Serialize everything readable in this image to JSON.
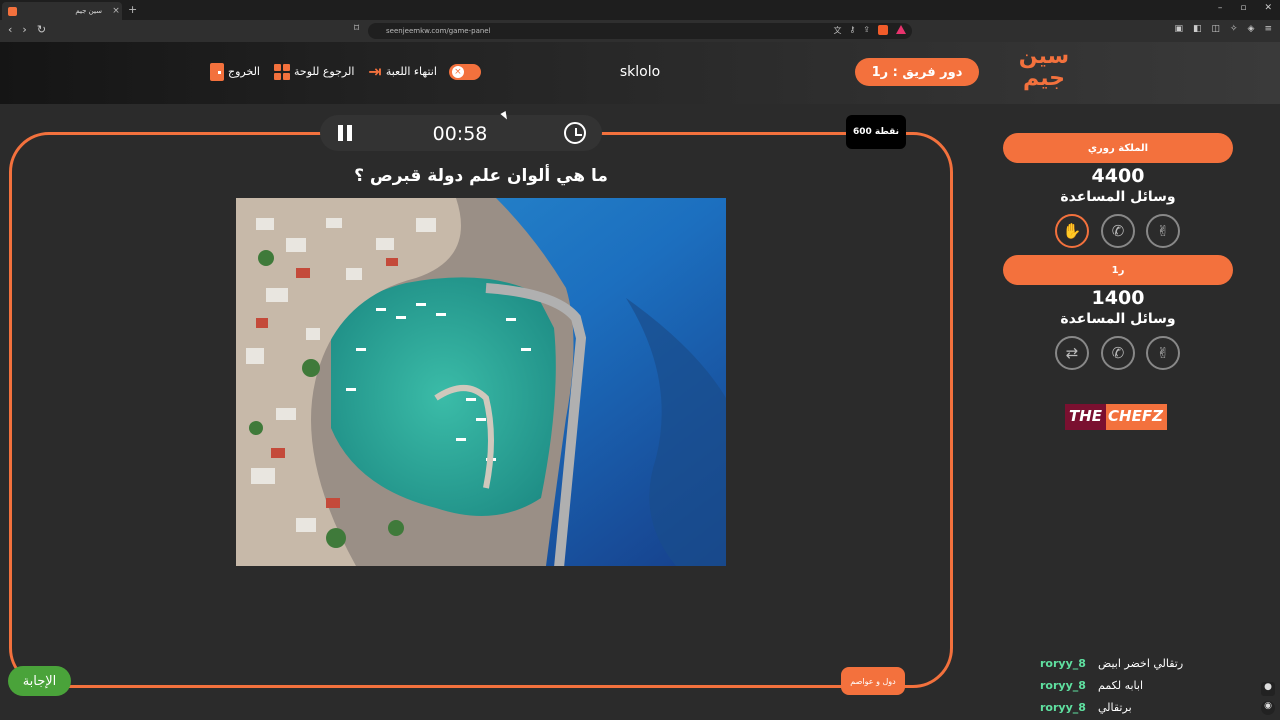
{
  "browser": {
    "tab_title": "سين جيم",
    "url": "seenjeemkw.com/game-panel"
  },
  "header": {
    "logo_text_line1": "سين",
    "logo_text_line2": "جيم",
    "turn_label": "دور فريق : ر1",
    "game_name": "sklolo",
    "end_game_label": "انتهاء اللعبة",
    "back_label": "الرجوع للوحة",
    "exit_label": "الخروج"
  },
  "board": {
    "timer": "00:58",
    "points": "600 نقطة",
    "question": "ما هي ألوان علم دولة قبرص ؟",
    "category": "دول و عواصم",
    "answer_label": "الإجابة"
  },
  "teams": [
    {
      "name": "الملكة روري",
      "score": "4400",
      "aids_label": "وسائل المساعدة"
    },
    {
      "name": "ر1",
      "score": "1400",
      "aids_label": "وسائل المساعدة"
    }
  ],
  "sponsor": {
    "part1": "THE",
    "part2": "CHEFZ"
  },
  "chat": [
    {
      "user": "roryy_8",
      "message": "رتقالي اخضر ابيض"
    },
    {
      "user": "roryy_8",
      "message": "ابابه لكمم"
    },
    {
      "user": "roryy_8",
      "message": "برتقالي"
    }
  ],
  "colors": {
    "accent": "#f3713d",
    "answer_green": "#4aa33a",
    "chat_user": "#5fe0a0"
  }
}
